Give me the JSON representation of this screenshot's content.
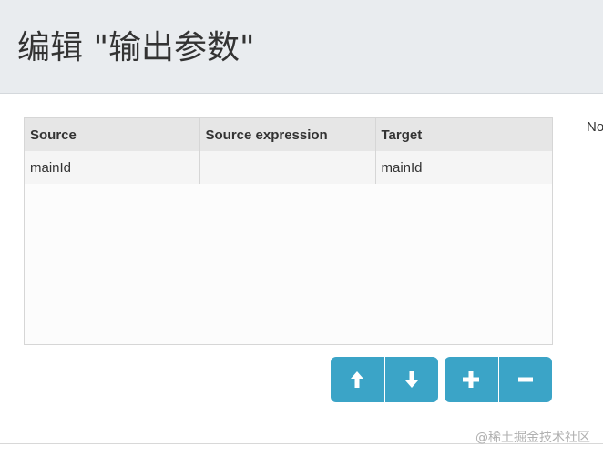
{
  "header": {
    "title": "编辑 \"输出参数\""
  },
  "table": {
    "columns": [
      "Source",
      "Source expression",
      "Target"
    ],
    "rows": [
      [
        "mainId",
        "",
        "mainId"
      ]
    ]
  },
  "side_text": "No",
  "buttons": {
    "move_up_icon": "arrow-up-icon",
    "move_down_icon": "arrow-down-icon",
    "add_icon": "plus-icon",
    "remove_icon": "minus-icon",
    "color": "#3ba4c7"
  },
  "watermark": "@稀土掘金技术社区"
}
